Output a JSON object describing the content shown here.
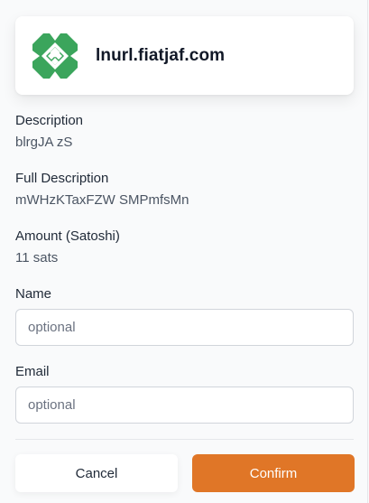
{
  "publisher": {
    "domain": "lnurl.fiatjaf.com",
    "logo_icon": "identicon-logo",
    "logo_color": "#3ba55c"
  },
  "fields": {
    "description": {
      "label": "Description",
      "value": "blrgJA zS"
    },
    "full_description": {
      "label": "Full Description",
      "value": "mWHzKTaxFZW SMPmfsMn"
    },
    "amount": {
      "label": "Amount (Satoshi)",
      "value": "11 sats"
    }
  },
  "form": {
    "name": {
      "label": "Name",
      "placeholder": "optional",
      "value": ""
    },
    "email": {
      "label": "Email",
      "placeholder": "optional",
      "value": ""
    }
  },
  "actions": {
    "cancel_label": "Cancel",
    "confirm_label": "Confirm",
    "confirm_color": "#e07627"
  }
}
